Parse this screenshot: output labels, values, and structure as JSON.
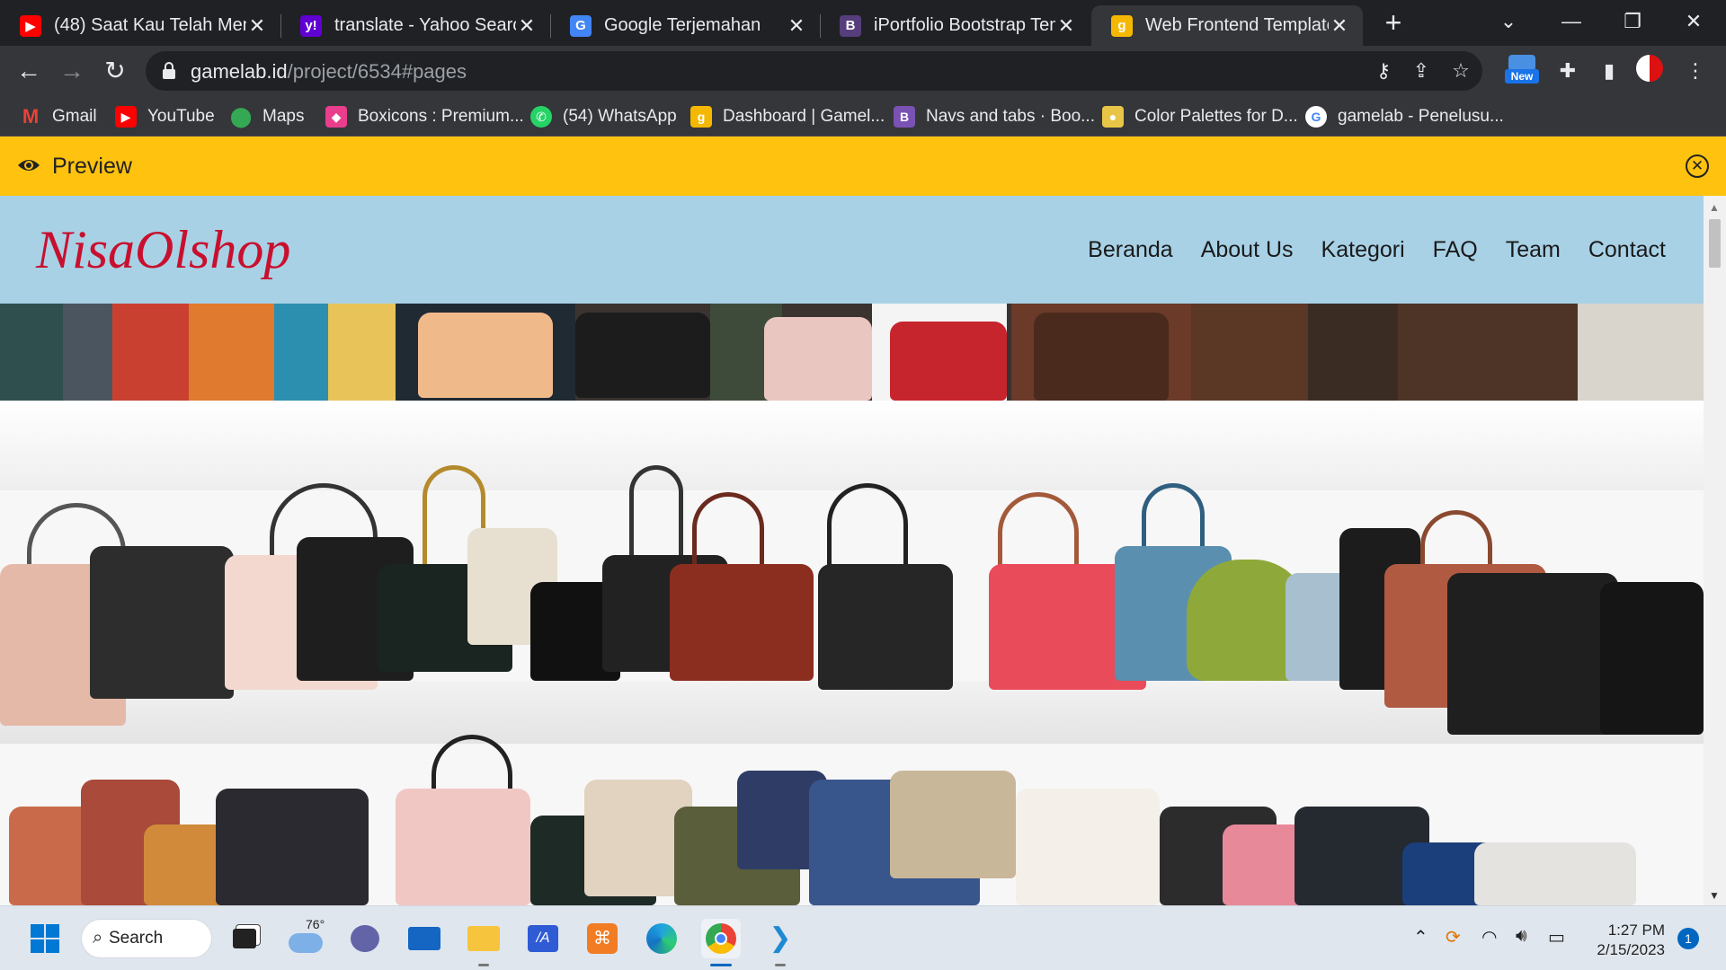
{
  "browser": {
    "tabs": [
      {
        "title": "(48) Saat Kau Telah Menge",
        "icon": "youtube-icon",
        "color": "#ff0000"
      },
      {
        "title": "translate - Yahoo Search R",
        "icon": "yahoo-icon",
        "color": "#6001d2"
      },
      {
        "title": "Google Terjemahan",
        "icon": "google-translate-icon",
        "color": "#4285f4"
      },
      {
        "title": "iPortfolio Bootstrap Temp",
        "icon": "bootstrap-icon",
        "color": "#563d7c"
      },
      {
        "title": "Web Frontend Template |",
        "icon": "gamelab-icon",
        "color": "#f5b800"
      }
    ],
    "url_host": "gamelab.id",
    "url_path": "/project/6534#pages",
    "extension_badge": "New",
    "bookmarks": [
      {
        "label": "Gmail",
        "icon": "gmail-icon",
        "color": "#ea4335"
      },
      {
        "label": "YouTube",
        "icon": "youtube-icon",
        "color": "#ff0000"
      },
      {
        "label": "Maps",
        "icon": "maps-icon",
        "color": "#34a853"
      },
      {
        "label": "Boxicons : Premium...",
        "icon": "boxicons-icon",
        "color": "#e83e8c"
      },
      {
        "label": "(54) WhatsApp",
        "icon": "whatsapp-icon",
        "color": "#25d366"
      },
      {
        "label": "Dashboard | Gamel...",
        "icon": "gamelab-icon",
        "color": "#f5b800"
      },
      {
        "label": "Navs and tabs · Boo...",
        "icon": "bootstrap-icon",
        "color": "#7952b3"
      },
      {
        "label": "Color Palettes for D...",
        "icon": "palette-icon",
        "color": "#e8c547"
      },
      {
        "label": "gamelab - Penelusu...",
        "icon": "google-icon",
        "color": "#4285f4"
      }
    ]
  },
  "preview": {
    "label": "Preview",
    "bar_color": "#fec20f"
  },
  "site": {
    "brand": "NisaOlshop",
    "brand_color": "#c8102e",
    "nav_bg": "#a8d1e6",
    "menu": [
      "Beranda",
      "About Us",
      "Kategori",
      "FAQ",
      "Team",
      "Contact"
    ]
  },
  "taskbar": {
    "search_label": "Search",
    "weather_temp": "76°",
    "time": "1:27 PM",
    "date": "2/15/2023",
    "notifications": "1"
  }
}
